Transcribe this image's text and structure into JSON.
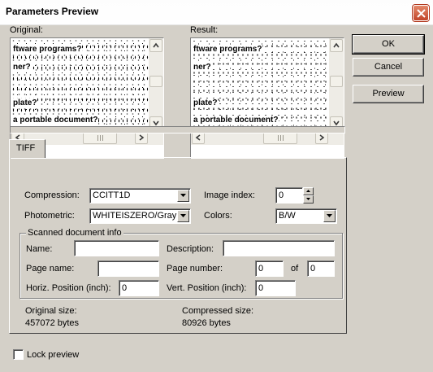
{
  "window": {
    "title": "Parameters Preview"
  },
  "preview": {
    "original_label": "Original:",
    "result_label": "Result:",
    "lines": [
      "ftware programs?",
      "ner?",
      "plate?",
      "a portable document?"
    ]
  },
  "buttons": {
    "ok": "OK",
    "cancel": "Cancel",
    "preview": "Preview"
  },
  "tab": {
    "label": "TIFF"
  },
  "form": {
    "compression_label": "Compression:",
    "compression_value": "CCITT1D",
    "image_index_label": "Image index:",
    "image_index_value": "0",
    "photometric_label": "Photometric:",
    "photometric_value": "WHITEISZERO/Gray",
    "colors_label": "Colors:",
    "colors_value": "B/W"
  },
  "scanned": {
    "title": "Scanned document info",
    "name_label": "Name:",
    "name_value": "",
    "description_label": "Description:",
    "description_value": "",
    "page_name_label": "Page name:",
    "page_name_value": "",
    "page_number_label": "Page number:",
    "page_number_value": "0",
    "of_label": "of",
    "page_total_value": "0",
    "horiz_label": "Horiz. Position (inch):",
    "horiz_value": "0",
    "vert_label": "Vert. Position (inch):",
    "vert_value": "0"
  },
  "sizes": {
    "original_label": "Original size:",
    "original_value": "457072 bytes",
    "compressed_label": "Compressed size:",
    "compressed_value": "80926 bytes"
  },
  "lock_preview": {
    "label": "Lock preview",
    "checked": false
  },
  "icons": {
    "close": "close-icon",
    "arrow_up": "arrow-up-icon",
    "arrow_down": "arrow-down-icon",
    "arrow_left": "arrow-left-icon",
    "arrow_right": "arrow-right-icon",
    "dropdown": "chevron-down-icon"
  }
}
